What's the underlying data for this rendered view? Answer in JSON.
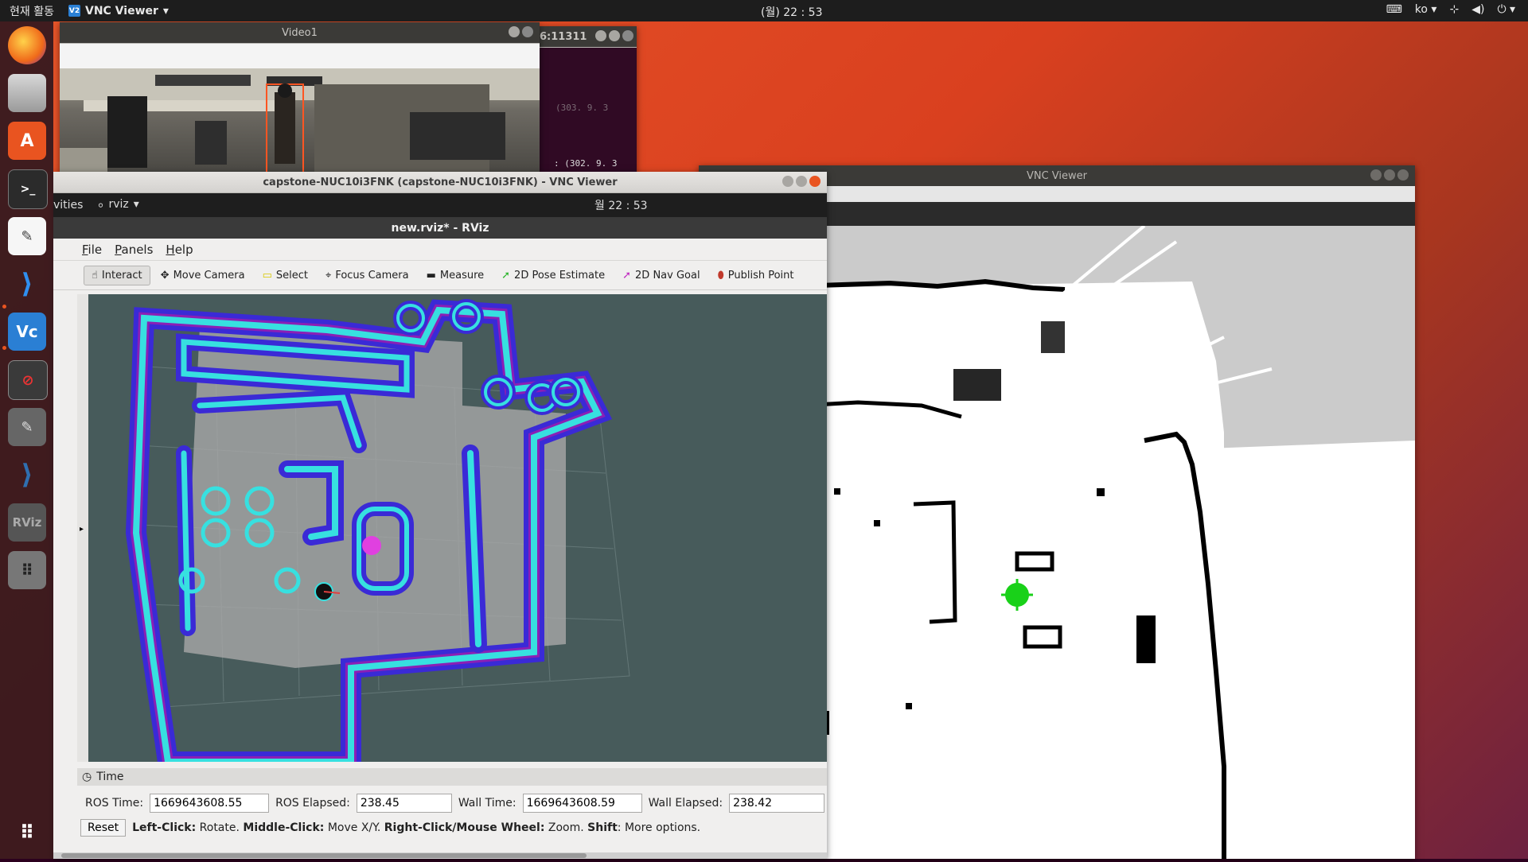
{
  "topbar": {
    "activities": "현재 활동",
    "app_name": "VNC Viewer",
    "app_icon_text": "V2",
    "clock": "(월) 22 : 53",
    "lang": "ko"
  },
  "dock": {
    "icons": [
      "firefox-icon",
      "files-icon",
      "software-center-icon",
      "terminal-icon",
      "text-editor-icon",
      "vscode-icon",
      "vnc-viewer-icon",
      "unknown-app-icon",
      "text-editor-icon",
      "vscode-icon",
      "rviz-icon",
      "app-grid-icon",
      "show-apps-icon"
    ],
    "rviz_label": "RViz"
  },
  "video_window": {
    "title": "Video1"
  },
  "terminal_window": {
    "title_fragment": "6:11311",
    "lines": [
      "(303. 9. 3",
      ": (302. 9. 3"
    ]
  },
  "vnc_right": {
    "title": "VNC Viewer"
  },
  "rviz_window": {
    "outer_title": "capstone-NUC10i3FNK (capstone-NUC10i3FNK) - VNC Viewer",
    "inner_activities": "vities",
    "inner_app": "rviz",
    "inner_clock": "월 22 : 53",
    "rviz_title": "new.rviz* - RViz",
    "menu": [
      "File",
      "Panels",
      "Help"
    ],
    "tools": [
      {
        "label": "Interact",
        "icon": "hand-icon"
      },
      {
        "label": "Move Camera",
        "icon": "move-camera-icon"
      },
      {
        "label": "Select",
        "icon": "select-icon"
      },
      {
        "label": "Focus Camera",
        "icon": "focus-camera-icon"
      },
      {
        "label": "Measure",
        "icon": "measure-icon"
      },
      {
        "label": "2D Pose Estimate",
        "icon": "pose-estimate-icon"
      },
      {
        "label": "2D Nav Goal",
        "icon": "nav-goal-icon"
      },
      {
        "label": "Publish Point",
        "icon": "publish-point-icon"
      }
    ],
    "time_panel": {
      "title": "Time",
      "ros_time_label": "ROS Time:",
      "ros_time": "1669643608.55",
      "ros_elapsed_label": "ROS Elapsed:",
      "ros_elapsed": "238.45",
      "wall_time_label": "Wall Time:",
      "wall_time": "1669643608.59",
      "wall_elapsed_label": "Wall Elapsed:",
      "wall_elapsed": "238.42"
    },
    "help": {
      "reset": "Reset",
      "left_click": "Left-Click:",
      "left_click_desc": "Rotate.",
      "middle_click": "Middle-Click:",
      "middle_click_desc": "Move X/Y.",
      "right_click": "Right-Click/Mouse Wheel:",
      "right_click_desc": "Zoom.",
      "shift": "Shift",
      "shift_desc": ": More options."
    }
  },
  "colors": {
    "ubuntu_orange": "#e95420",
    "costmap_cyan": "#37e0e0",
    "costmap_purple": "#8b1fb5",
    "costmap_blue": "#3a2ad6",
    "goal_magenta": "#e040e0",
    "robot_green": "#19d119"
  }
}
